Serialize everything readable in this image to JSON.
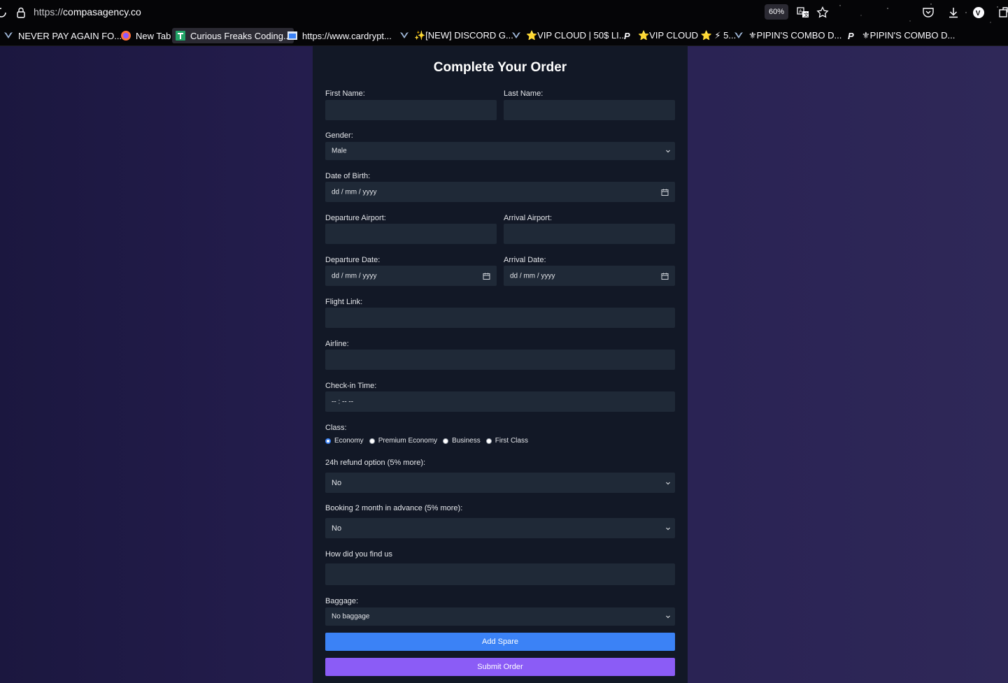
{
  "browser": {
    "url_scheme": "https://",
    "url_host": "compasagency.co",
    "zoom": "60%",
    "bookmarks": [
      {
        "label": "NEVER PAY AGAIN FO...",
        "icon": "shield-icon"
      },
      {
        "label": "New Tab",
        "icon": "firefox-icon"
      },
      {
        "label": "Curious Freaks Coding...",
        "icon": "sheets-icon"
      },
      {
        "label": "https://www.cardrypt...",
        "icon": "page-icon"
      },
      {
        "label": "✨[NEW] DISCORD G...",
        "icon": "shield-icon"
      },
      {
        "label": "⭐VIP CLOUD | 50$ LI...",
        "icon": "shield-icon"
      },
      {
        "label": "⭐VIP CLOUD ⭐ ⚡ 5...",
        "icon": "p-icon"
      },
      {
        "label": "⚜PIPIN'S COMBO D...",
        "icon": "shield-icon"
      },
      {
        "label": "⚜PIPIN'S COMBO D...",
        "icon": "p-icon"
      }
    ]
  },
  "form": {
    "title": "Complete Your Order",
    "first_name_label": "First Name:",
    "last_name_label": "Last Name:",
    "gender_label": "Gender:",
    "gender_value": "Male",
    "dob_label": "Date of Birth:",
    "date_placeholder": "dd / mm / yyyy",
    "departure_airport_label": "Departure Airport:",
    "arrival_airport_label": "Arrival Airport:",
    "departure_date_label": "Departure Date:",
    "arrival_date_label": "Arrival Date:",
    "flight_link_label": "Flight Link:",
    "airline_label": "Airline:",
    "checkin_label": "Check-in Time:",
    "time_placeholder": "-- : --   --",
    "class_label": "Class:",
    "class_options": [
      "Economy",
      "Premium Economy",
      "Business",
      "First Class"
    ],
    "class_selected": "Economy",
    "refund_label": "24h refund option (5% more):",
    "refund_value": "No",
    "advance_label": "Booking 2 month in advance (5% more):",
    "advance_value": "No",
    "find_us_label": "How did you find us",
    "baggage_label": "Baggage:",
    "baggage_value": "No baggage",
    "add_spare_label": "Add Spare",
    "submit_label": "Submit Order"
  },
  "colors": {
    "page_bg": "#241d4d",
    "card_bg": "#121826",
    "field_bg": "#1f2937",
    "blue_button": "#3b82f6",
    "purple_button": "#8b5cf6"
  }
}
